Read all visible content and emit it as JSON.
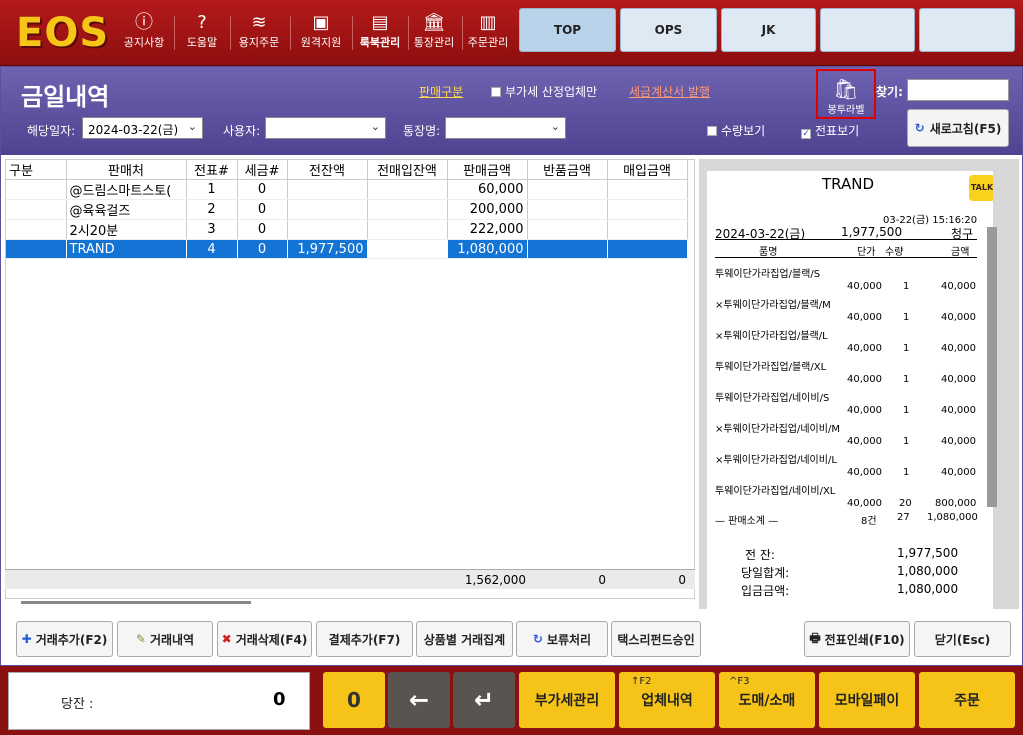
{
  "app": {
    "logo": "EOS"
  },
  "topnav": [
    {
      "label": "공지사항",
      "icon": "notice-icon"
    },
    {
      "label": "도움말",
      "icon": "help-icon"
    },
    {
      "label": "용지주문",
      "icon": "paper-icon"
    },
    {
      "label": "원격지원",
      "icon": "remote-icon"
    },
    {
      "label": "룩북관리",
      "icon": "lookbook-icon"
    },
    {
      "label": "통장관리",
      "icon": "bank-icon"
    },
    {
      "label": "주문관리",
      "icon": "order-box-icon"
    }
  ],
  "tabs": [
    {
      "label": "TOP"
    },
    {
      "label": "OPS"
    },
    {
      "label": "JK"
    },
    {
      "label": ""
    },
    {
      "label": ""
    }
  ],
  "dialog": {
    "title": "금일내역",
    "sales_type_link": "판매구분",
    "vat_only_label": "부가세 산정업체만",
    "tax_invoice_link": "세금계산서 발행",
    "label_button": "봉투라벨",
    "search_label": "찾기:",
    "date_label": "해당일자:",
    "date_value": "2024-03-22(금)",
    "user_label": "사용자:",
    "user_value": "",
    "account_label": "통장명:",
    "account_value": "",
    "qty_view_label": "수량보기",
    "slip_view_label": "전표보기",
    "slip_view_checked": true,
    "refresh_label": "새로고침(F5)"
  },
  "table": {
    "columns": [
      "구분",
      "판매처",
      "전표#",
      "세금#",
      "전잔액",
      "전매입잔액",
      "판매금액",
      "반품금액",
      "매입금액"
    ],
    "rows": [
      [
        "",
        "@드림스마트스토(",
        "1",
        "0",
        "",
        "",
        "60,000",
        "",
        ""
      ],
      [
        "",
        "@육육걸즈",
        "2",
        "0",
        "",
        "",
        "200,000",
        "",
        ""
      ],
      [
        "",
        "2시20분",
        "3",
        "0",
        "",
        "",
        "222,000",
        "",
        ""
      ],
      [
        "",
        "TRAND",
        "4",
        "0",
        "1,977,500",
        "",
        "1,080,000",
        "",
        ""
      ]
    ],
    "selected_row": 3,
    "totals": {
      "sales": "1,562,000",
      "returns": "0",
      "purchase": "0"
    }
  },
  "receipt": {
    "store": "TRAND",
    "badge": "TALK",
    "datetime": "03-22(금) 15:16:20",
    "date": "2024-03-22(금)",
    "amount": "1,977,500",
    "type": "청구",
    "head_item": "품명",
    "head_price": "단가",
    "head_qty": "수량",
    "head_amount": "금액",
    "items": [
      {
        "name": "투웨이단가라집업/블랙/S",
        "price": "40,000",
        "qty": "1",
        "amount": "40,000"
      },
      {
        "name": "×투웨이단가라집업/블랙/M",
        "price": "40,000",
        "qty": "1",
        "amount": "40,000"
      },
      {
        "name": "×투웨이단가라집업/블랙/L",
        "price": "40,000",
        "qty": "1",
        "amount": "40,000"
      },
      {
        "name": "투웨이단가라집업/블랙/XL",
        "price": "40,000",
        "qty": "1",
        "amount": "40,000"
      },
      {
        "name": "투웨이단가라집업/네이비/S",
        "price": "40,000",
        "qty": "1",
        "amount": "40,000"
      },
      {
        "name": "×투웨이단가라집업/네이비/M",
        "price": "40,000",
        "qty": "1",
        "amount": "40,000"
      },
      {
        "name": "×투웨이단가라집업/네이비/L",
        "price": "40,000",
        "qty": "1",
        "amount": "40,000"
      },
      {
        "name": "투웨이단가라집업/네이비/XL",
        "price": "40,000",
        "qty": "20",
        "amount": "800,000"
      }
    ],
    "subtotal_label": "— 판매소계 —",
    "subtotal_count": "8건",
    "subtotal_qty": "27",
    "subtotal_amount": "1,080,000",
    "prev_balance_label": "전      잔:",
    "prev_balance": "1,977,500",
    "day_total_label": "당일합계:",
    "day_total": "1,080,000",
    "deposit_label": "입금금액:",
    "deposit": "1,080,000"
  },
  "bottom_buttons": [
    {
      "label": "거래추가(F2)",
      "icon": "plus-icon"
    },
    {
      "label": "거래내역",
      "icon": "pencil-icon"
    },
    {
      "label": "거래삭제(F4)",
      "icon": "delete-x-icon"
    },
    {
      "label": "결제추가(F7)",
      "icon": ""
    },
    {
      "label": "상품별 거래집계",
      "icon": ""
    },
    {
      "label": "보류처리",
      "icon": "refresh-icon"
    },
    {
      "label": "택스리펀드승인",
      "icon": ""
    },
    {
      "label": "전표인쇄(F10)",
      "icon": "printer-icon"
    },
    {
      "label": "닫기(Esc)",
      "icon": ""
    }
  ],
  "footer": {
    "balance_label": "당잔 :",
    "balance_value": "0",
    "key_zero": "0",
    "key_back": "←",
    "key_enter": "↵",
    "keys": [
      {
        "label": "부가세관리",
        "hint": ""
      },
      {
        "label": "업체내역",
        "hint": "↑F2"
      },
      {
        "label": "도매/소매",
        "hint": "^F3"
      },
      {
        "label": "모바일페이",
        "hint": ""
      },
      {
        "label": "주문",
        "hint": ""
      }
    ]
  }
}
